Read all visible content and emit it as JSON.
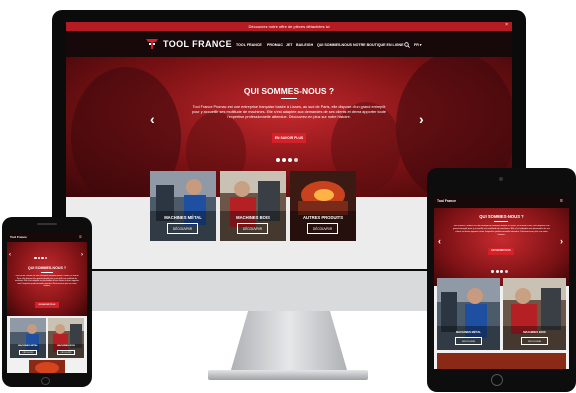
{
  "announcement": {
    "text": "Découvrez notre offre de pièces détachées ici",
    "close_label": "×"
  },
  "brand": {
    "name": "TOOL FRANCE",
    "short_name": "Tool France",
    "accent_color": "#d42026",
    "dark_color": "#17090a"
  },
  "nav": {
    "items": [
      "TOOL FRANCE",
      "PROMAC",
      "JET",
      "BAILEIGH",
      "QUI SOMMES-NOUS",
      "NOTRE BOUTIQUE EN LIGNE"
    ],
    "search_icon": "search-icon",
    "lang_label": "FR ▾",
    "menu_icon": "hamburger-menu-icon"
  },
  "hero": {
    "title": "QUI SOMMES-NOUS ?",
    "text": "Tool France Promac est une entreprise française basée à Lisses, au sud de Paris, elle dispose d'un grand entrepôt pour y accueillir ses multitude de machines. Elle s'est adaptée aux demandes de ses clients et devra apporter toute l'expertise professionnelle attendue. Découvrez-en plus sur notre histoire.",
    "button_label": "EN SAVOIR PLUS",
    "prev_label": "‹",
    "next_label": "›",
    "slide_count": 4,
    "active_slide": 3
  },
  "categories": [
    {
      "title": "MACHINES MÉTAL",
      "button_label": "DÉCOUVRIR"
    },
    {
      "title": "MACHINES BOIS",
      "button_label": "DÉCOUVRIR"
    },
    {
      "title": "AUTRES PRODUITS",
      "button_label": "DÉCOUVRIR"
    }
  ]
}
